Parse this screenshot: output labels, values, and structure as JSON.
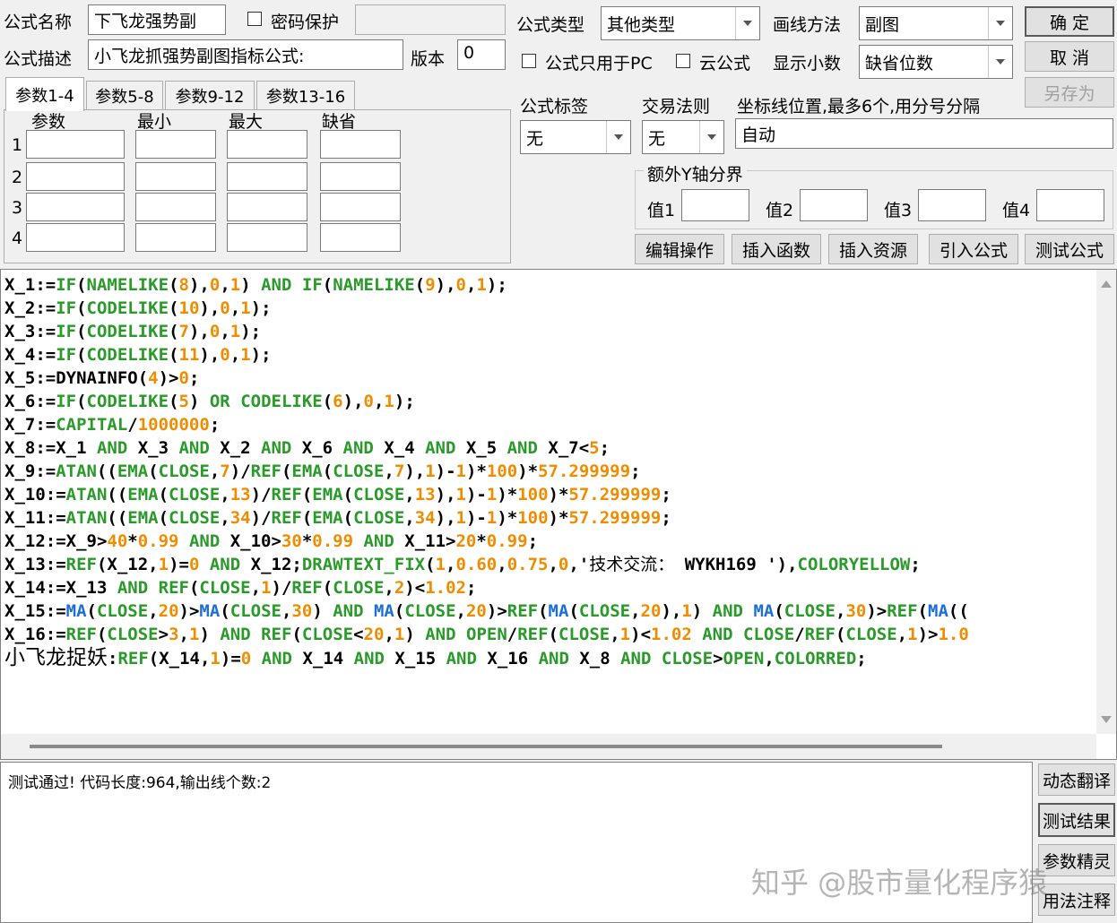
{
  "form": {
    "name_label": "公式名称",
    "name_value": "下飞龙强势副",
    "password_label": "密码保护",
    "desc_label": "公式描述",
    "desc_value": "小飞龙抓强势副图指标公式:",
    "version_label": "版本",
    "version_value": "0",
    "type_label": "公式类型",
    "type_value": "其他类型",
    "draw_label": "画线方法",
    "draw_value": "副图",
    "pc_only_label": "公式只用于PC",
    "cloud_label": "云公式",
    "decimal_label": "显示小数",
    "decimal_value": "缺省位数",
    "tag_label": "公式标签",
    "tag_value": "无",
    "rule_label": "交易法则",
    "rule_value": "无",
    "coord_label": "坐标线位置,最多6个,用分号分隔",
    "coord_value": "自动",
    "yaxis_label": "额外Y轴分界",
    "yaxis_values": [
      "值1",
      "值2",
      "值3",
      "值4"
    ]
  },
  "buttons": {
    "ok": "确  定",
    "cancel": "取  消",
    "save_as": "另存为",
    "edit": "编辑操作",
    "insert_func": "插入函数",
    "insert_res": "插入资源",
    "import": "引入公式",
    "test": "测试公式",
    "translate": "动态翻译",
    "result": "测试结果",
    "param": "参数精灵",
    "usage": "用法注释"
  },
  "tabs": [
    "参数1-4",
    "参数5-8",
    "参数9-12",
    "参数13-16"
  ],
  "params": {
    "headers": [
      "参数",
      "最小",
      "最大",
      "缺省"
    ],
    "rows": [
      "1",
      "2",
      "3",
      "4"
    ]
  },
  "code_lines": [
    [
      [
        "v",
        "X_1:="
      ],
      [
        "f",
        "IF"
      ],
      [
        "o",
        "("
      ],
      [
        "f",
        "NAMELIKE"
      ],
      [
        "o",
        "("
      ],
      [
        "n",
        "8"
      ],
      [
        "o",
        "),"
      ],
      [
        "n",
        "0"
      ],
      [
        "o",
        ","
      ],
      [
        "n",
        "1"
      ],
      [
        "o",
        ") "
      ],
      [
        "and",
        "AND"
      ],
      [
        "o",
        " "
      ],
      [
        "f",
        "IF"
      ],
      [
        "o",
        "("
      ],
      [
        "f",
        "NAMELIKE"
      ],
      [
        "o",
        "("
      ],
      [
        "n",
        "9"
      ],
      [
        "o",
        "),"
      ],
      [
        "n",
        "0"
      ],
      [
        "o",
        ","
      ],
      [
        "n",
        "1"
      ],
      [
        "o",
        ");"
      ]
    ],
    [
      [
        "v",
        "X_2:="
      ],
      [
        "f",
        "IF"
      ],
      [
        "o",
        "("
      ],
      [
        "f",
        "CODELIKE"
      ],
      [
        "o",
        "("
      ],
      [
        "n",
        "10"
      ],
      [
        "o",
        "),"
      ],
      [
        "n",
        "0"
      ],
      [
        "o",
        ","
      ],
      [
        "n",
        "1"
      ],
      [
        "o",
        ");"
      ]
    ],
    [
      [
        "v",
        "X_3:="
      ],
      [
        "f",
        "IF"
      ],
      [
        "o",
        "("
      ],
      [
        "f",
        "CODELIKE"
      ],
      [
        "o",
        "("
      ],
      [
        "n",
        "7"
      ],
      [
        "o",
        "),"
      ],
      [
        "n",
        "0"
      ],
      [
        "o",
        ","
      ],
      [
        "n",
        "1"
      ],
      [
        "o",
        ");"
      ]
    ],
    [
      [
        "v",
        "X_4:="
      ],
      [
        "f",
        "IF"
      ],
      [
        "o",
        "("
      ],
      [
        "f",
        "CODELIKE"
      ],
      [
        "o",
        "("
      ],
      [
        "n",
        "11"
      ],
      [
        "o",
        "),"
      ],
      [
        "n",
        "0"
      ],
      [
        "o",
        ","
      ],
      [
        "n",
        "1"
      ],
      [
        "o",
        ");"
      ]
    ],
    [
      [
        "v",
        "X_5:=DYNAINFO("
      ],
      [
        "n",
        "4"
      ],
      [
        "o",
        ")>"
      ],
      [
        "n",
        "0"
      ],
      [
        "o",
        ";"
      ]
    ],
    [
      [
        "v",
        "X_6:="
      ],
      [
        "f",
        "IF"
      ],
      [
        "o",
        "("
      ],
      [
        "f",
        "CODELIKE"
      ],
      [
        "o",
        "("
      ],
      [
        "n",
        "5"
      ],
      [
        "o",
        ") "
      ],
      [
        "and",
        "OR"
      ],
      [
        "o",
        " "
      ],
      [
        "f",
        "CODELIKE"
      ],
      [
        "o",
        "("
      ],
      [
        "n",
        "6"
      ],
      [
        "o",
        "),"
      ],
      [
        "n",
        "0"
      ],
      [
        "o",
        ","
      ],
      [
        "n",
        "1"
      ],
      [
        "o",
        ");"
      ]
    ],
    [
      [
        "v",
        "X_7:="
      ],
      [
        "f",
        "CAPITAL"
      ],
      [
        "o",
        "/"
      ],
      [
        "n",
        "1000000"
      ],
      [
        "o",
        ";"
      ]
    ],
    [
      [
        "v",
        "X_8:=X_1 "
      ],
      [
        "and",
        "AND"
      ],
      [
        "v",
        " X_3 "
      ],
      [
        "and",
        "AND"
      ],
      [
        "v",
        " X_2 "
      ],
      [
        "and",
        "AND"
      ],
      [
        "v",
        " X_6 "
      ],
      [
        "and",
        "AND"
      ],
      [
        "v",
        " X_4 "
      ],
      [
        "and",
        "AND"
      ],
      [
        "v",
        " X_5 "
      ],
      [
        "and",
        "AND"
      ],
      [
        "v",
        " X_7<"
      ],
      [
        "n",
        "5"
      ],
      [
        "o",
        ";"
      ]
    ],
    [
      [
        "v",
        "X_9:="
      ],
      [
        "f",
        "ATAN"
      ],
      [
        "o",
        "(("
      ],
      [
        "f",
        "EMA"
      ],
      [
        "o",
        "("
      ],
      [
        "f",
        "CLOSE"
      ],
      [
        "o",
        ","
      ],
      [
        "n",
        "7"
      ],
      [
        "o",
        ")/"
      ],
      [
        "f",
        "REF"
      ],
      [
        "o",
        "("
      ],
      [
        "f",
        "EMA"
      ],
      [
        "o",
        "("
      ],
      [
        "f",
        "CLOSE"
      ],
      [
        "o",
        ","
      ],
      [
        "n",
        "7"
      ],
      [
        "o",
        "),"
      ],
      [
        "n",
        "1"
      ],
      [
        "o",
        ")-"
      ],
      [
        "n",
        "1"
      ],
      [
        "o",
        ")*"
      ],
      [
        "n",
        "100"
      ],
      [
        "o",
        ")*"
      ],
      [
        "n",
        "57.299999"
      ],
      [
        "o",
        ";"
      ]
    ],
    [
      [
        "v",
        "X_10:="
      ],
      [
        "f",
        "ATAN"
      ],
      [
        "o",
        "(("
      ],
      [
        "f",
        "EMA"
      ],
      [
        "o",
        "("
      ],
      [
        "f",
        "CLOSE"
      ],
      [
        "o",
        ","
      ],
      [
        "n",
        "13"
      ],
      [
        "o",
        ")/"
      ],
      [
        "f",
        "REF"
      ],
      [
        "o",
        "("
      ],
      [
        "f",
        "EMA"
      ],
      [
        "o",
        "("
      ],
      [
        "f",
        "CLOSE"
      ],
      [
        "o",
        ","
      ],
      [
        "n",
        "13"
      ],
      [
        "o",
        "),"
      ],
      [
        "n",
        "1"
      ],
      [
        "o",
        ")-"
      ],
      [
        "n",
        "1"
      ],
      [
        "o",
        ")*"
      ],
      [
        "n",
        "100"
      ],
      [
        "o",
        ")*"
      ],
      [
        "n",
        "57.299999"
      ],
      [
        "o",
        ";"
      ]
    ],
    [
      [
        "v",
        "X_11:="
      ],
      [
        "f",
        "ATAN"
      ],
      [
        "o",
        "(("
      ],
      [
        "f",
        "EMA"
      ],
      [
        "o",
        "("
      ],
      [
        "f",
        "CLOSE"
      ],
      [
        "o",
        ","
      ],
      [
        "n",
        "34"
      ],
      [
        "o",
        ")/"
      ],
      [
        "f",
        "REF"
      ],
      [
        "o",
        "("
      ],
      [
        "f",
        "EMA"
      ],
      [
        "o",
        "("
      ],
      [
        "f",
        "CLOSE"
      ],
      [
        "o",
        ","
      ],
      [
        "n",
        "34"
      ],
      [
        "o",
        "),"
      ],
      [
        "n",
        "1"
      ],
      [
        "o",
        ")-"
      ],
      [
        "n",
        "1"
      ],
      [
        "o",
        ")*"
      ],
      [
        "n",
        "100"
      ],
      [
        "o",
        ")*"
      ],
      [
        "n",
        "57.299999"
      ],
      [
        "o",
        ";"
      ]
    ],
    [
      [
        "v",
        "X_12:=X_9>"
      ],
      [
        "n",
        "40"
      ],
      [
        "o",
        "*"
      ],
      [
        "n",
        "0.99"
      ],
      [
        "o",
        " "
      ],
      [
        "and",
        "AND"
      ],
      [
        "v",
        " X_10>"
      ],
      [
        "n",
        "30"
      ],
      [
        "o",
        "*"
      ],
      [
        "n",
        "0.99"
      ],
      [
        "o",
        " "
      ],
      [
        "and",
        "AND"
      ],
      [
        "v",
        " X_11>"
      ],
      [
        "n",
        "20"
      ],
      [
        "o",
        "*"
      ],
      [
        "n",
        "0.99"
      ],
      [
        "o",
        ";"
      ]
    ],
    [
      [
        "v",
        "X_13:="
      ],
      [
        "f",
        "REF"
      ],
      [
        "o",
        "(X_12,"
      ],
      [
        "n",
        "1"
      ],
      [
        "o",
        ")="
      ],
      [
        "n",
        "0"
      ],
      [
        "o",
        " "
      ],
      [
        "and",
        "AND"
      ],
      [
        "v",
        " X_12;"
      ],
      [
        "f",
        "DRAWTEXT_FIX"
      ],
      [
        "o",
        "("
      ],
      [
        "n",
        "1"
      ],
      [
        "o",
        ","
      ],
      [
        "n",
        "0.60"
      ],
      [
        "o",
        ","
      ],
      [
        "n",
        "0.75"
      ],
      [
        "o",
        ","
      ],
      [
        "n",
        "0"
      ],
      [
        "o",
        ",'"
      ],
      [
        "s",
        "技术交流："
      ],
      [
        "v",
        " WYKH169 "
      ],
      [
        "o",
        "'),"
      ],
      [
        "c",
        "COLORYELLOW"
      ],
      [
        "o",
        ";"
      ]
    ],
    [
      [
        "v",
        "X_14:=X_13 "
      ],
      [
        "and",
        "AND"
      ],
      [
        "v",
        " "
      ],
      [
        "f",
        "REF"
      ],
      [
        "o",
        "("
      ],
      [
        "f",
        "CLOSE"
      ],
      [
        "o",
        ","
      ],
      [
        "n",
        "1"
      ],
      [
        "o",
        ")/"
      ],
      [
        "f",
        "REF"
      ],
      [
        "o",
        "("
      ],
      [
        "f",
        "CLOSE"
      ],
      [
        "o",
        ","
      ],
      [
        "n",
        "2"
      ],
      [
        "o",
        ")<"
      ],
      [
        "n",
        "1.02"
      ],
      [
        "o",
        ";"
      ]
    ],
    [
      [
        "v",
        "X_15:="
      ],
      [
        "b",
        "MA"
      ],
      [
        "o",
        "("
      ],
      [
        "f",
        "CLOSE"
      ],
      [
        "o",
        ","
      ],
      [
        "n",
        "20"
      ],
      [
        "o",
        ")>"
      ],
      [
        "b",
        "MA"
      ],
      [
        "o",
        "("
      ],
      [
        "f",
        "CLOSE"
      ],
      [
        "o",
        ","
      ],
      [
        "n",
        "30"
      ],
      [
        "o",
        ") "
      ],
      [
        "and",
        "AND"
      ],
      [
        "o",
        " "
      ],
      [
        "b",
        "MA"
      ],
      [
        "o",
        "("
      ],
      [
        "f",
        "CLOSE"
      ],
      [
        "o",
        ","
      ],
      [
        "n",
        "20"
      ],
      [
        "o",
        ")>"
      ],
      [
        "f",
        "REF"
      ],
      [
        "o",
        "("
      ],
      [
        "b",
        "MA"
      ],
      [
        "o",
        "("
      ],
      [
        "f",
        "CLOSE"
      ],
      [
        "o",
        ","
      ],
      [
        "n",
        "20"
      ],
      [
        "o",
        "),"
      ],
      [
        "n",
        "1"
      ],
      [
        "o",
        ") "
      ],
      [
        "and",
        "AND"
      ],
      [
        "o",
        " "
      ],
      [
        "b",
        "MA"
      ],
      [
        "o",
        "("
      ],
      [
        "f",
        "CLOSE"
      ],
      [
        "o",
        ","
      ],
      [
        "n",
        "30"
      ],
      [
        "o",
        ")>"
      ],
      [
        "f",
        "REF"
      ],
      [
        "o",
        "("
      ],
      [
        "b",
        "MA"
      ],
      [
        "o",
        "(("
      ]
    ],
    [
      [
        "v",
        "X_16:="
      ],
      [
        "f",
        "REF"
      ],
      [
        "o",
        "("
      ],
      [
        "f",
        "CLOSE"
      ],
      [
        "o",
        ">"
      ],
      [
        "n",
        "3"
      ],
      [
        "o",
        ","
      ],
      [
        "n",
        "1"
      ],
      [
        "o",
        ") "
      ],
      [
        "and",
        "AND"
      ],
      [
        "o",
        " "
      ],
      [
        "f",
        "REF"
      ],
      [
        "o",
        "("
      ],
      [
        "f",
        "CLOSE"
      ],
      [
        "o",
        "<"
      ],
      [
        "n",
        "20"
      ],
      [
        "o",
        ","
      ],
      [
        "n",
        "1"
      ],
      [
        "o",
        ") "
      ],
      [
        "and",
        "AND"
      ],
      [
        "o",
        " "
      ],
      [
        "f",
        "OPEN"
      ],
      [
        "o",
        "/"
      ],
      [
        "f",
        "REF"
      ],
      [
        "o",
        "("
      ],
      [
        "f",
        "CLOSE"
      ],
      [
        "o",
        ","
      ],
      [
        "n",
        "1"
      ],
      [
        "o",
        ")<"
      ],
      [
        "n",
        "1.02"
      ],
      [
        "o",
        " "
      ],
      [
        "and",
        "AND"
      ],
      [
        "o",
        " "
      ],
      [
        "f",
        "CLOSE"
      ],
      [
        "o",
        "/"
      ],
      [
        "f",
        "REF"
      ],
      [
        "o",
        "("
      ],
      [
        "f",
        "CLOSE"
      ],
      [
        "o",
        ","
      ],
      [
        "n",
        "1"
      ],
      [
        "o",
        ")>"
      ],
      [
        "n",
        "1.0"
      ]
    ],
    [
      [
        "cn",
        "小飞龙捉妖"
      ],
      [
        "o",
        ":"
      ],
      [
        "f",
        "REF"
      ],
      [
        "o",
        "(X_14,"
      ],
      [
        "n",
        "1"
      ],
      [
        "o",
        ")="
      ],
      [
        "n",
        "0"
      ],
      [
        "o",
        " "
      ],
      [
        "and",
        "AND"
      ],
      [
        "v",
        " X_14 "
      ],
      [
        "and",
        "AND"
      ],
      [
        "v",
        " X_15 "
      ],
      [
        "and",
        "AND"
      ],
      [
        "v",
        " X_16 "
      ],
      [
        "and",
        "AND"
      ],
      [
        "v",
        " X_8 "
      ],
      [
        "and",
        "AND"
      ],
      [
        "o",
        " "
      ],
      [
        "f",
        "CLOSE"
      ],
      [
        "o",
        ">"
      ],
      [
        "f",
        "OPEN"
      ],
      [
        "o",
        ","
      ],
      [
        "c",
        "COLORRED"
      ],
      [
        "o",
        ";"
      ]
    ]
  ],
  "output": {
    "message": "测试通过! 代码长度:964,输出线个数:2"
  },
  "watermark": "知乎 @股市量化程序猿",
  "colors": {
    "function": "#2a9a2a",
    "number": "#f08c00",
    "ma": "#1d6fd6"
  }
}
